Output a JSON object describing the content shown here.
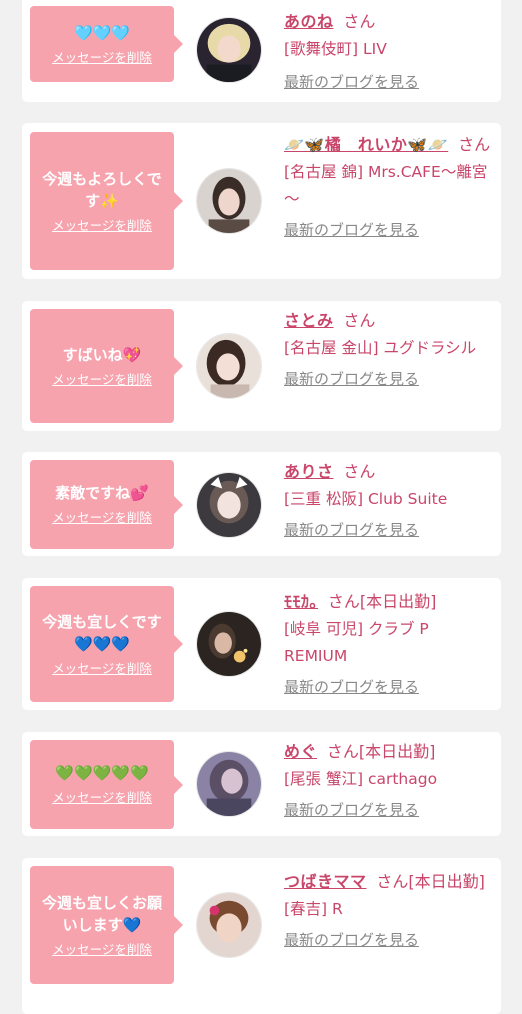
{
  "delete_label": "メッセージを削除",
  "blog_label": "最新のブログを見る",
  "entries": [
    {
      "message": "🩵🩵🩵",
      "name": "あのね",
      "suffix": "さん",
      "location": "[歌舞伎町] LIV"
    },
    {
      "message": "今週もよろしくです✨",
      "name": "🪐🦋橘　れいか🦋🪐",
      "suffix": "さん",
      "location": "[名古屋 錦] Mrs.CAFE～離宮～"
    },
    {
      "message": "すばいね💖",
      "name": "さとみ",
      "suffix": "さん",
      "location": "[名古屋 金山] ユグドラシル"
    },
    {
      "message": "素敵ですね💕",
      "name": "ありさ",
      "suffix": "さん",
      "location": "[三重 松阪] Club Suite"
    },
    {
      "message": "今週も宜しくです💙💙💙",
      "name": "ﾓﾓｶ｡",
      "suffix": "さん[本日出勤]",
      "location": "[岐阜 可児] クラブ PREMIUM"
    },
    {
      "message": "💚💚💚💚💚",
      "name": "めぐ",
      "suffix": "さん[本日出勤]",
      "location": "[尾張 蟹江] carthago"
    },
    {
      "message": "今週も宜しくお願いします💙",
      "name": "つばきママ",
      "suffix": "さん[本日出勤]",
      "location": "[春吉] R"
    }
  ],
  "colors": {
    "background": "#f1f1f1",
    "bubble": "#f7a3ae",
    "name": "#c9466a",
    "link_gray": "#888888"
  }
}
